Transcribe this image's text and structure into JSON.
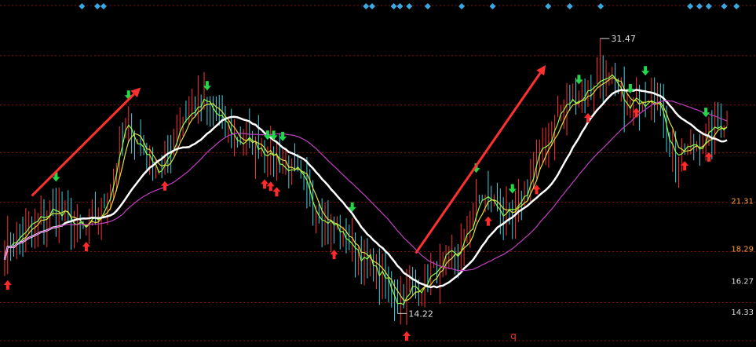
{
  "chart_data": {
    "type": "candlestick",
    "title": "",
    "xlabel": "",
    "ylabel": "",
    "bars": 240,
    "ylim": [
      13.3,
      33.2
    ],
    "y_ticks": [
      {
        "value": 21.31,
        "label": "21.31",
        "color": "#ff9a2e"
      },
      {
        "value": 18.29,
        "label": "18.29",
        "color": "#ff9a2e"
      },
      {
        "value": 16.27,
        "label": "16.27",
        "color": "#dddddd"
      },
      {
        "value": 14.33,
        "label": "14.33",
        "color": "#dddddd"
      }
    ],
    "max_marker": {
      "value": 31.47,
      "label": "31.47",
      "bar": 197
    },
    "min_marker": {
      "value": 14.22,
      "label": "14.22",
      "bar": 130
    },
    "close_anchors": [
      [
        0,
        18.4
      ],
      [
        10,
        19.8
      ],
      [
        16,
        20.8
      ],
      [
        26,
        19.3
      ],
      [
        32,
        20.4
      ],
      [
        40,
        26.0
      ],
      [
        46,
        24.4
      ],
      [
        52,
        23.0
      ],
      [
        58,
        26.4
      ],
      [
        66,
        27.4
      ],
      [
        76,
        25.2
      ],
      [
        86,
        24.6
      ],
      [
        96,
        22.8
      ],
      [
        106,
        20.2
      ],
      [
        114,
        18.6
      ],
      [
        124,
        16.6
      ],
      [
        130,
        15.0
      ],
      [
        140,
        16.4
      ],
      [
        150,
        18.0
      ],
      [
        158,
        21.6
      ],
      [
        168,
        20.0
      ],
      [
        176,
        23.8
      ],
      [
        184,
        27.0
      ],
      [
        192,
        28.2
      ],
      [
        198,
        29.2
      ],
      [
        206,
        27.0
      ],
      [
        214,
        28.4
      ],
      [
        222,
        24.0
      ],
      [
        230,
        25.0
      ],
      [
        239,
        26.4
      ]
    ],
    "series": [
      {
        "key": "ma_fast",
        "color": "#8cff4a",
        "period": 3
      },
      {
        "key": "ma_mid",
        "color": "#e0e040",
        "period": 6
      },
      {
        "key": "ma_main",
        "color": "#ffffff",
        "period": 20
      },
      {
        "key": "ma_slow",
        "color": "#c040c0",
        "period": 40
      }
    ],
    "candle_colors": {
      "up": "#ff3030",
      "down": "#40d0e0"
    },
    "buy_signals": [
      1,
      27,
      53,
      86,
      88,
      90,
      109,
      133,
      160,
      176,
      193,
      209,
      225,
      233
    ],
    "sell_signals": [
      17,
      41,
      67,
      87,
      89,
      92,
      115,
      156,
      168,
      190,
      207,
      212,
      232
    ],
    "signal_colors": {
      "buy": "#ff2a2a",
      "sell": "#22d84a"
    },
    "top_markers": [
      25,
      30,
      32,
      117,
      119,
      126,
      128,
      131,
      137,
      148,
      158,
      176,
      183,
      193,
      222,
      225,
      228,
      233,
      237
    ],
    "top_marker_color": "#3aa8e0",
    "trend_arrows": [
      {
        "from": [
          9,
          21.6
        ],
        "to": [
          45,
          28.4
        ]
      },
      {
        "from": [
          136,
          18.0
        ],
        "to": [
          179,
          29.8
        ]
      }
    ],
    "grid_lines": [
      30.4,
      27.3,
      24.3,
      21.2,
      18.1,
      14.9
    ],
    "grid_color": "#8a1010",
    "bottom_label": "q"
  }
}
